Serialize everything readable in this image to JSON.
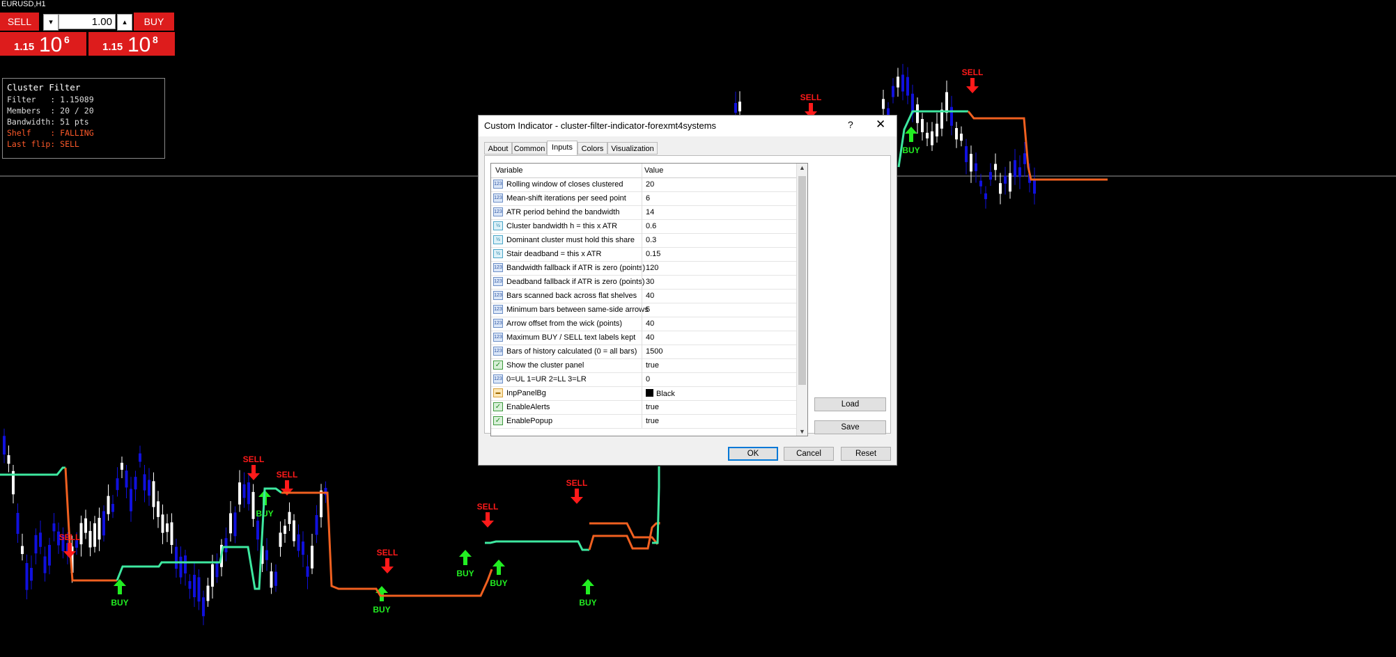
{
  "window": {
    "symbol": "EURUSD,H1"
  },
  "one_click": {
    "sell_label": "SELL",
    "buy_label": "BUY",
    "lot": "1.00",
    "down_arrow": "▾",
    "up_arrow": "▴",
    "sell_price_small": "1.15",
    "sell_price_big": "10",
    "sell_price_sup": "6",
    "buy_price_small": "1.15",
    "buy_price_big": "10",
    "buy_price_sup": "8"
  },
  "cluster_panel": {
    "title": "Cluster Filter",
    "filter": "Filter   : 1.15089",
    "members": "Members  : 20 / 20",
    "bandwidth": "Bandwidth: 51 pts",
    "shelf": "Shelf    : FALLING",
    "last_flip": "Last flip: SELL"
  },
  "dialog": {
    "title": "Custom Indicator - cluster-filter-indicator-forexmt4systems",
    "help": "?",
    "close": "✕",
    "tabs": [
      "About",
      "Common",
      "Inputs",
      "Colors",
      "Visualization"
    ],
    "active_tab": "Inputs",
    "col_variable": "Variable",
    "col_value": "Value",
    "rows": [
      {
        "name": "Rolling window of closes clustered",
        "value": "20",
        "icon": "int"
      },
      {
        "name": "Mean-shift iterations per seed point",
        "value": "6",
        "icon": "int"
      },
      {
        "name": "ATR period behind the bandwidth",
        "value": "14",
        "icon": "int"
      },
      {
        "name": "Cluster bandwidth h = this x ATR",
        "value": "0.6",
        "icon": "dbl"
      },
      {
        "name": "Dominant cluster must hold this share",
        "value": "0.3",
        "icon": "dbl"
      },
      {
        "name": "Stair deadband = this x ATR",
        "value": "0.15",
        "icon": "dbl"
      },
      {
        "name": "Bandwidth fallback if ATR is zero (points)",
        "value": "120",
        "icon": "int"
      },
      {
        "name": "Deadband fallback if ATR is zero (points)",
        "value": "30",
        "icon": "int"
      },
      {
        "name": "Bars scanned back across flat shelves",
        "value": "40",
        "icon": "int"
      },
      {
        "name": "Minimum bars between same-side arrows",
        "value": "5",
        "icon": "int"
      },
      {
        "name": "Arrow offset from the wick (points)",
        "value": "40",
        "icon": "int"
      },
      {
        "name": "Maximum BUY / SELL text labels kept",
        "value": "40",
        "icon": "int"
      },
      {
        "name": "Bars of history calculated (0 = all bars)",
        "value": "1500",
        "icon": "int"
      },
      {
        "name": "Show the cluster panel",
        "value": "true",
        "icon": "bool"
      },
      {
        "name": "0=UL 1=UR 2=LL 3=LR",
        "value": "0",
        "icon": "int"
      },
      {
        "name": "InpPanelBg",
        "value": "Black",
        "icon": "col"
      },
      {
        "name": "EnableAlerts",
        "value": "true",
        "icon": "bool"
      },
      {
        "name": "EnablePopup",
        "value": "true",
        "icon": "bool"
      }
    ],
    "load": "Load",
    "save": "Save",
    "ok": "OK",
    "cancel": "Cancel",
    "reset": "Reset"
  },
  "chart_labels": {
    "sell": "SELL",
    "buy": "BUY"
  },
  "colors": {
    "bull": "#ffffff",
    "bear": "#1010dd",
    "line_up": "#3ee8a0",
    "line_down": "#f06020",
    "sell": "#ff1a1a",
    "buy": "#22ee22"
  }
}
